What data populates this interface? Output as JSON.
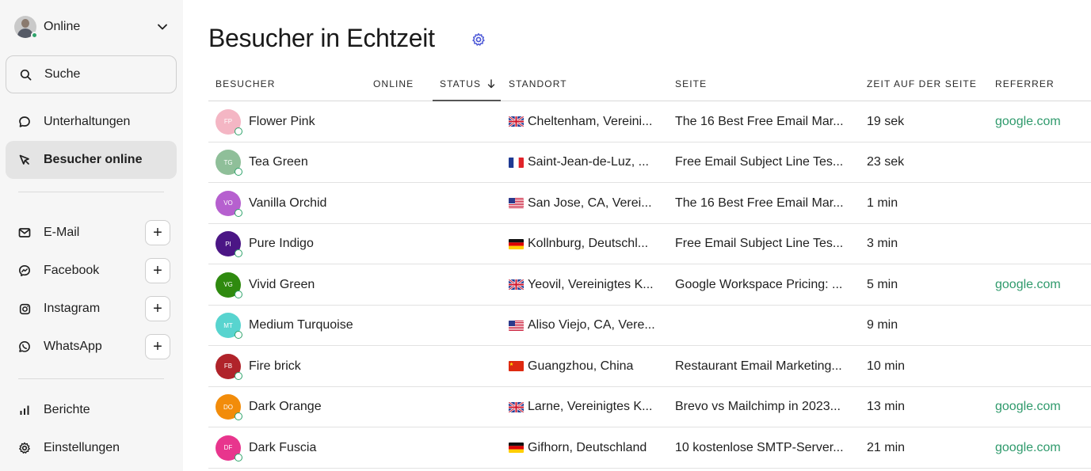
{
  "sidebar": {
    "status_label": "Online",
    "search_label": "Suche",
    "nav": {
      "conversations": "Unterhaltungen",
      "visitors_online": "Besucher online",
      "email": "E-Mail",
      "facebook": "Facebook",
      "instagram": "Instagram",
      "whatsapp": "WhatsApp",
      "reports": "Berichte",
      "settings": "Einstellungen"
    },
    "plus_label": "+"
  },
  "main": {
    "title": "Besucher in Echtzeit",
    "columns": {
      "visitor": "Besucher",
      "online": "Online",
      "status": "Status",
      "location": "Standort",
      "page": "Seite",
      "time": "Zeit auf der Seite",
      "referrer": "Referrer"
    },
    "rows": [
      {
        "initials": "FP",
        "name": "Flower Pink",
        "color": "#f4b6c4",
        "flag": "uk",
        "location": "Cheltenham, Vereini...",
        "page": "The 16 Best Free Email Mar...",
        "time": "19 sek",
        "referrer": "google.com"
      },
      {
        "initials": "TG",
        "name": "Tea Green",
        "color": "#8fbf99",
        "flag": "fr",
        "location": "Saint-Jean-de-Luz, ...",
        "page": "Free Email Subject Line Tes...",
        "time": "23 sek",
        "referrer": ""
      },
      {
        "initials": "VO",
        "name": "Vanilla Orchid",
        "color": "#b660cf",
        "flag": "us",
        "location": "San Jose, CA, Verei...",
        "page": "The 16 Best Free Email Mar...",
        "time": "1 min",
        "referrer": ""
      },
      {
        "initials": "PI",
        "name": "Pure Indigo",
        "color": "#4b1685",
        "flag": "de",
        "location": "Kollnburg, Deutschl...",
        "page": "Free Email Subject Line Tes...",
        "time": "3 min",
        "referrer": ""
      },
      {
        "initials": "VG",
        "name": "Vivid Green",
        "color": "#2f8a0f",
        "flag": "uk",
        "location": "Yeovil, Vereinigtes K...",
        "page": "Google Workspace Pricing: ...",
        "time": "5 min",
        "referrer": "google.com"
      },
      {
        "initials": "MT",
        "name": "Medium Turquoise",
        "color": "#58d4cf",
        "flag": "us",
        "location": "Aliso Viejo, CA, Vere...",
        "page": "",
        "time": "9 min",
        "referrer": ""
      },
      {
        "initials": "FB",
        "name": "Fire brick",
        "color": "#b0232a",
        "flag": "cn",
        "location": "Guangzhou, China",
        "page": "Restaurant Email Marketing...",
        "time": "10 min",
        "referrer": ""
      },
      {
        "initials": "DO",
        "name": "Dark Orange",
        "color": "#f28c0a",
        "flag": "uk",
        "location": "Larne, Vereinigtes K...",
        "page": "Brevo vs Mailchimp in 2023...",
        "time": "13 min",
        "referrer": "google.com"
      },
      {
        "initials": "DF",
        "name": "Dark Fuscia",
        "color": "#e8358d",
        "flag": "de",
        "location": "Gifhorn, Deutschland",
        "page": "10 kostenlose SMTP-Server...",
        "time": "21 min",
        "referrer": "google.com"
      }
    ]
  },
  "colors": {
    "online_green": "#2fa36b",
    "referrer_green": "#2f9a6c",
    "accent_blue": "#4a56d6"
  }
}
